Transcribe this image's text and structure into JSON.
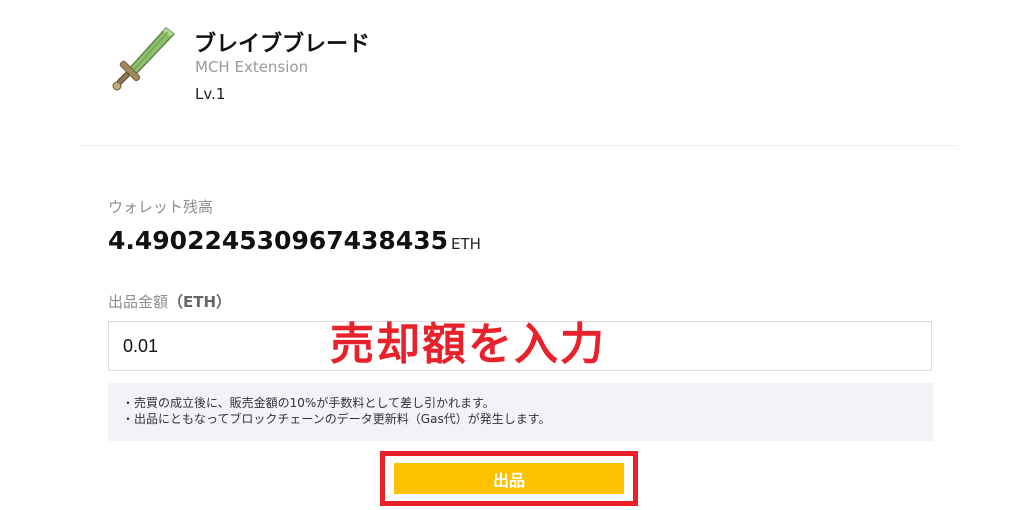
{
  "item": {
    "icon": "sword-icon",
    "name": "ブレイブブレード",
    "extension": "MCH Extension",
    "level": "Lv.1"
  },
  "wallet": {
    "label": "ウォレット残高",
    "balance": "4.490224530967438435",
    "unit": "ETH"
  },
  "price": {
    "label_main": "出品金額",
    "label_unit": "（ETH）",
    "value": "0.01"
  },
  "annotation": "売却額を入力",
  "notices": [
    "・売買の成立後に、販売金額の10%が手数料として差し引かれます。",
    "・出品にともなってブロックチェーンのデータ更新料（Gas代）が発生します。"
  ],
  "submit_label": "出品",
  "colors": {
    "accent_button": "#fcc200",
    "annotation_red": "#e8212b",
    "notice_bg": "#f1f3f8"
  }
}
